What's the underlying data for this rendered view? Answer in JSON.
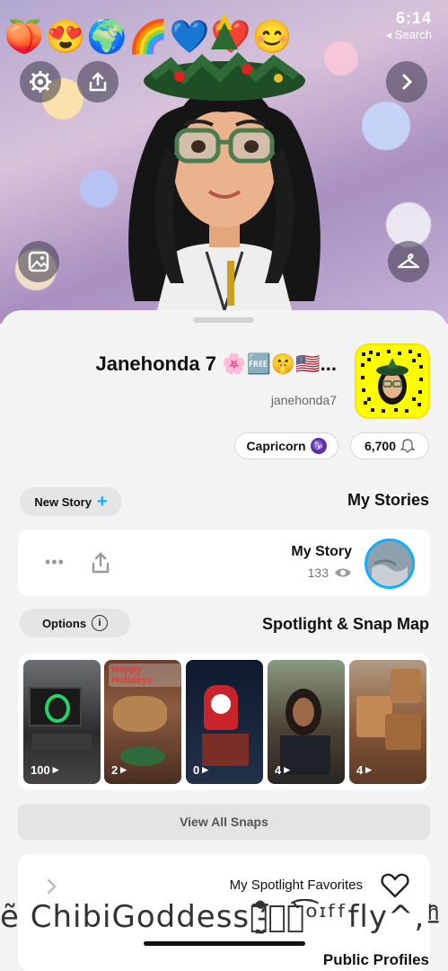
{
  "status": {
    "time": "6:14",
    "back_label": "Search"
  },
  "top_emojis": [
    "🍑",
    "😍",
    "🌍",
    "🌈",
    "💙",
    "❤️",
    "😊"
  ],
  "icons": {
    "settings": "gear-icon",
    "share": "share-icon",
    "forward": "chevron-right-icon",
    "gallery": "photo-icon",
    "outfit": "hanger-icon"
  },
  "profile": {
    "display_name": "Janehonda 7 🌸🆓🤫🇺🇸...",
    "username": "janehonda7",
    "snap_score": "6,700",
    "zodiac": "Capricorn"
  },
  "stories": {
    "title": "My Stories",
    "new_story_label": "New Story",
    "my_story_label": "My Story",
    "views": "133"
  },
  "spotlight": {
    "title": "Spotlight & Snap Map",
    "options_label": "Options",
    "thumbs": [
      {
        "count": "100"
      },
      {
        "count": "2",
        "caption": "Happy Holidays"
      },
      {
        "count": "0"
      },
      {
        "count": "4"
      },
      {
        "count": "4"
      }
    ],
    "view_all_label": "View All Snaps"
  },
  "favorites": {
    "label": "My Spotlight Favorites"
  },
  "public_profiles": {
    "title": "Public Profiles"
  },
  "overlay_text": "ẽ ChibiGoddess๒̵̮̰̅̊̀̀̌̒̔̀ͧͦ̀͡ᵒᶦᶠᶠfly^, ̵ͪ̑",
  "colors": {
    "accent": "#0fadff",
    "snap_yellow": "#fffc00",
    "zodiac": "#5a2ea6"
  }
}
